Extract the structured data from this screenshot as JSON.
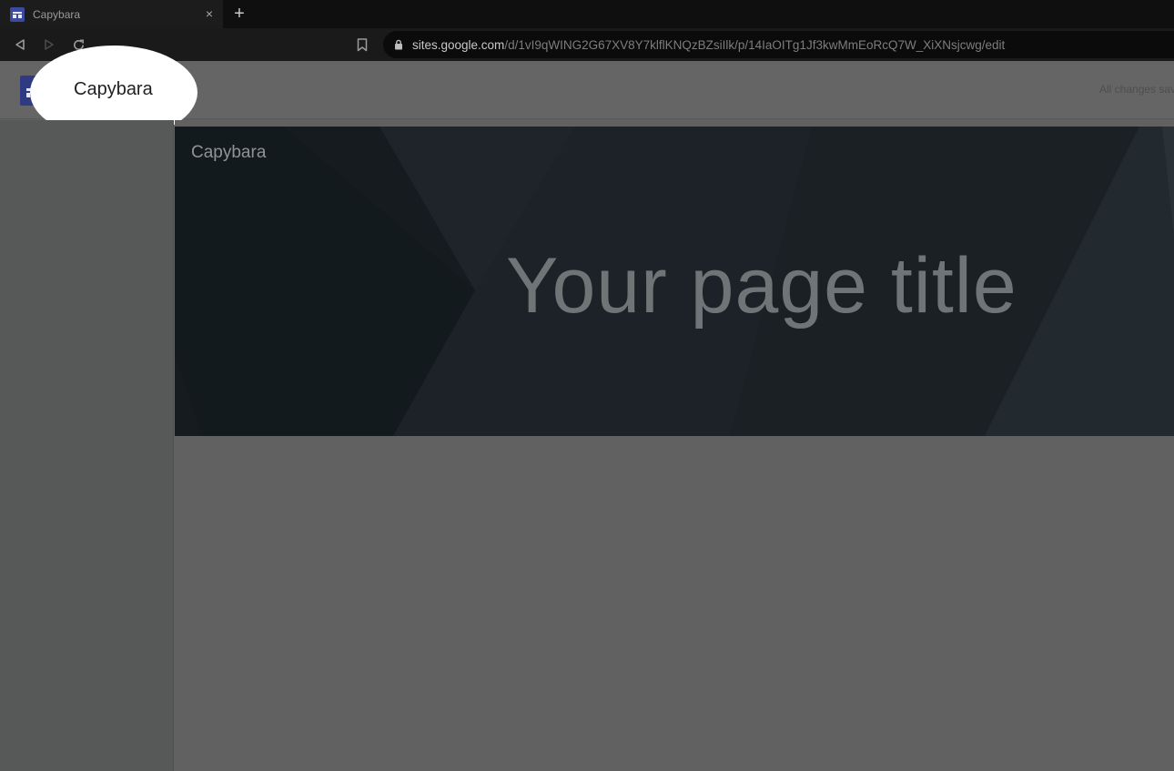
{
  "browser": {
    "tab_title": "Capybara",
    "tab_close": "×",
    "new_tab": "+",
    "url_host": "sites.google.com",
    "url_path": "/d/1vI9qWING2G67XV8Y7klflKNQzBZsiIlk/p/14IaOITg1Jf3kwMmEoRcQ7W_XiXNsjcwg/edit"
  },
  "header": {
    "site_name": "Capybara",
    "save_status": "All changes sav"
  },
  "hero": {
    "site_name": "Capybara",
    "page_title": "Your page title"
  },
  "colors": {
    "sites_brand": "#2e3a82",
    "hero_background": "#1b2025"
  }
}
